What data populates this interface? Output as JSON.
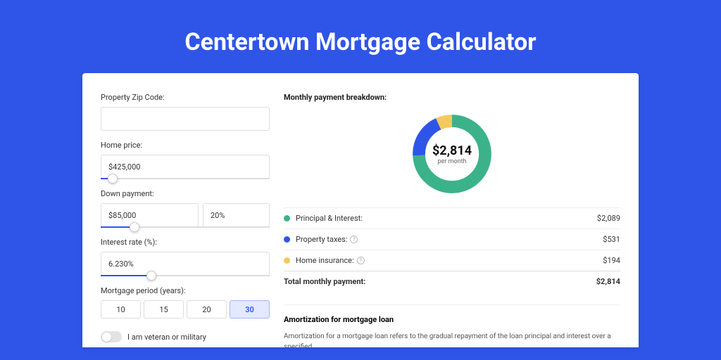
{
  "page": {
    "title": "Centertown Mortgage Calculator"
  },
  "form": {
    "zip": {
      "label": "Property Zip Code:",
      "value": ""
    },
    "home_price": {
      "label": "Home price:",
      "value": "$425,000",
      "slider_pct": 7
    },
    "down_payment": {
      "label": "Down payment:",
      "value": "$85,000",
      "pct_value": "20%",
      "slider_pct": 20
    },
    "interest": {
      "label": "Interest rate (%):",
      "value": "6.230%",
      "slider_pct": 30
    },
    "period": {
      "label": "Mortgage period (years):",
      "options": [
        "10",
        "15",
        "20",
        "30"
      ],
      "selected": "30"
    },
    "veteran": {
      "label": "I am veteran or military",
      "on": false
    }
  },
  "breakdown": {
    "title": "Monthly payment breakdown:",
    "center_amount": "$2,814",
    "center_sub": "per month",
    "items": [
      {
        "label": "Principal & Interest:",
        "value": "$2,089",
        "color": "#3bb28a"
      },
      {
        "label": "Property taxes:",
        "value": "$531",
        "color": "#2f55e8",
        "info": true
      },
      {
        "label": "Home insurance:",
        "value": "$194",
        "color": "#f4c95d",
        "info": true
      }
    ],
    "total": {
      "label": "Total monthly payment:",
      "value": "$2,814"
    }
  },
  "amort": {
    "title": "Amortization for mortgage loan",
    "body": "Amortization for a mortgage loan refers to the gradual repayment of the loan principal and interest over a specified"
  },
  "chart_data": {
    "type": "pie",
    "title": "Monthly payment breakdown",
    "series": [
      {
        "name": "Principal & Interest",
        "value": 2089,
        "color": "#3bb28a"
      },
      {
        "name": "Property taxes",
        "value": 531,
        "color": "#2f55e8"
      },
      {
        "name": "Home insurance",
        "value": 194,
        "color": "#f4c95d"
      }
    ],
    "total": 2814
  }
}
